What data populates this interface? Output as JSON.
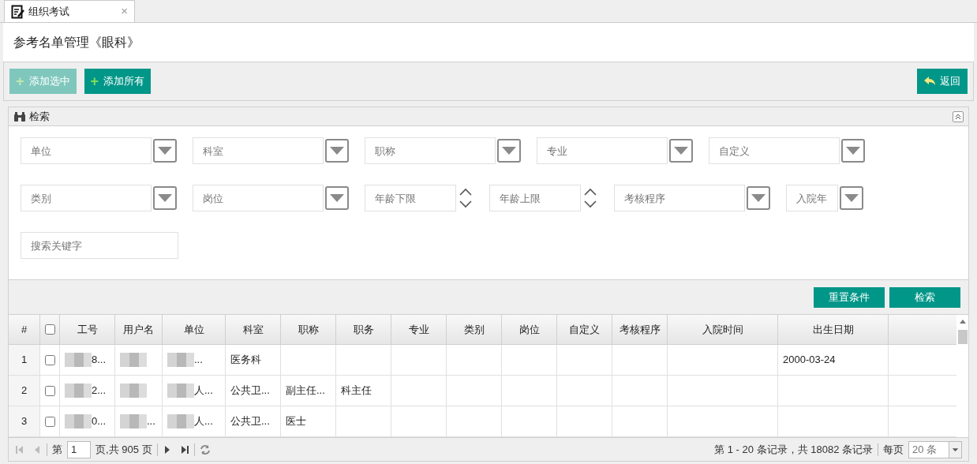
{
  "tab": {
    "title": "组织考试",
    "selected": true,
    "close": "×"
  },
  "page_title": "参考名单管理《眼科》",
  "toolbar": {
    "buttons": [
      {
        "label": "添加选中",
        "icon": "+",
        "disabled": true
      },
      {
        "label": "添加所有",
        "icon": "+",
        "disabled": false
      }
    ],
    "back_button": {
      "label": "返回"
    }
  },
  "search_panel": {
    "title": "检索",
    "field_rows": [
      [
        {
          "kind": "select",
          "placeholder": "单位"
        },
        {
          "kind": "select",
          "placeholder": "科室"
        },
        {
          "kind": "select",
          "placeholder": "职称"
        },
        {
          "kind": "select",
          "placeholder": "专业"
        },
        {
          "kind": "select",
          "placeholder": "自定义"
        }
      ],
      [
        {
          "kind": "select",
          "placeholder": "类别"
        },
        {
          "kind": "select",
          "placeholder": "岗位"
        },
        {
          "kind": "number",
          "placeholder": "年龄下限"
        },
        {
          "kind": "number",
          "placeholder": "年龄上限"
        },
        {
          "kind": "select",
          "placeholder": "考核程序"
        },
        {
          "kind": "short-select",
          "placeholder": "入院年"
        }
      ],
      [
        {
          "kind": "text",
          "placeholder": "搜索关键字"
        }
      ]
    ],
    "buttons": [
      "重置条件",
      "检索"
    ]
  },
  "table": {
    "select_all_checked": false,
    "columns": [
      "#",
      "",
      "工号",
      "用户名",
      "单位",
      "科室",
      "职称",
      "职务",
      "专业",
      "类别",
      "岗位",
      "自定义",
      "考核程序",
      "入院时间",
      "出生日期"
    ],
    "rows": [
      {
        "cells": [
          {
            "kind": "number",
            "text": "1"
          },
          {
            "kind": "checkbox",
            "checked": false
          },
          {
            "text": "8...",
            "redacted": true
          },
          {
            "text": "",
            "redacted": true
          },
          {
            "text": "...",
            "redacted": true
          },
          {
            "text": "医务科"
          },
          {
            "text": ""
          },
          {
            "text": ""
          },
          {
            "text": ""
          },
          {
            "text": ""
          },
          {
            "text": ""
          },
          {
            "text": ""
          },
          {
            "text": ""
          },
          {
            "text": ""
          },
          {
            "text": "2000-03-24"
          }
        ]
      },
      {
        "cells": [
          {
            "kind": "number",
            "text": "2"
          },
          {
            "kind": "checkbox",
            "checked": false
          },
          {
            "text": "2...",
            "redacted": true
          },
          {
            "text": "",
            "redacted": true
          },
          {
            "text": "人...",
            "redacted": true
          },
          {
            "text": "公共卫..."
          },
          {
            "text": "副主任..."
          },
          {
            "text": "科主任"
          },
          {
            "text": ""
          },
          {
            "text": ""
          },
          {
            "text": ""
          },
          {
            "text": ""
          },
          {
            "text": ""
          },
          {
            "text": ""
          },
          {
            "text": ""
          }
        ]
      },
      {
        "cells": [
          {
            "kind": "number",
            "text": "3"
          },
          {
            "kind": "checkbox",
            "checked": false
          },
          {
            "text": "0...",
            "redacted": true
          },
          {
            "text": "...",
            "redacted": true
          },
          {
            "text": "人...",
            "redacted": true
          },
          {
            "text": "公共卫..."
          },
          {
            "text": "医士"
          },
          {
            "text": ""
          },
          {
            "text": ""
          },
          {
            "text": ""
          },
          {
            "text": ""
          },
          {
            "text": ""
          },
          {
            "text": ""
          },
          {
            "text": ""
          },
          {
            "text": ""
          }
        ]
      }
    ]
  },
  "pager": {
    "page_label": "第",
    "page": "1",
    "page_total": "页,共 905 页",
    "summary": "第 1 - 20 条记录，共 18082 条记录",
    "per_page_label": "每页",
    "per_page": "20 条"
  }
}
